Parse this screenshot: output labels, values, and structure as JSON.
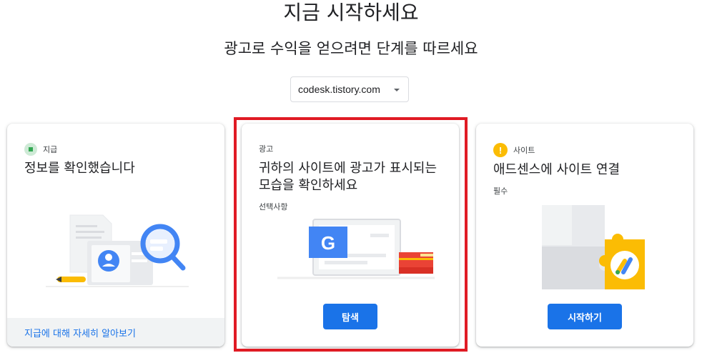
{
  "header": {
    "title": "지금 시작하세요",
    "subtitle": "광고로 수익을 얻으려면 단계를 따르세요"
  },
  "site_selector": {
    "value": "codesk.tistory.com",
    "icon": "dropdown-arrow-icon"
  },
  "cards": [
    {
      "status_label": "지급",
      "status_icon": "check-badge-icon",
      "title": "정보를 확인했습니다",
      "link_label": "지급에 대해 자세히 알아보기",
      "illustration": "document-id-magnifier-illustration"
    },
    {
      "status_label": "광고",
      "title": "귀하의 사이트에 광고가 표시되는 모습을 확인하세요",
      "note": "선택사항",
      "button_label": "탐색",
      "illustration": "laptop-ad-books-illustration",
      "highlight_color": "#e01b24"
    },
    {
      "status_label": "사이트",
      "status_icon": "warning-badge-icon",
      "title": "애드센스에 사이트 연결",
      "note": "필수",
      "button_label": "시작하기",
      "illustration": "puzzle-adsense-illustration"
    }
  ],
  "colors": {
    "primary": "#1a73e8",
    "success": "#34a853",
    "warning": "#fbbc04",
    "highlight": "#e01b24"
  }
}
